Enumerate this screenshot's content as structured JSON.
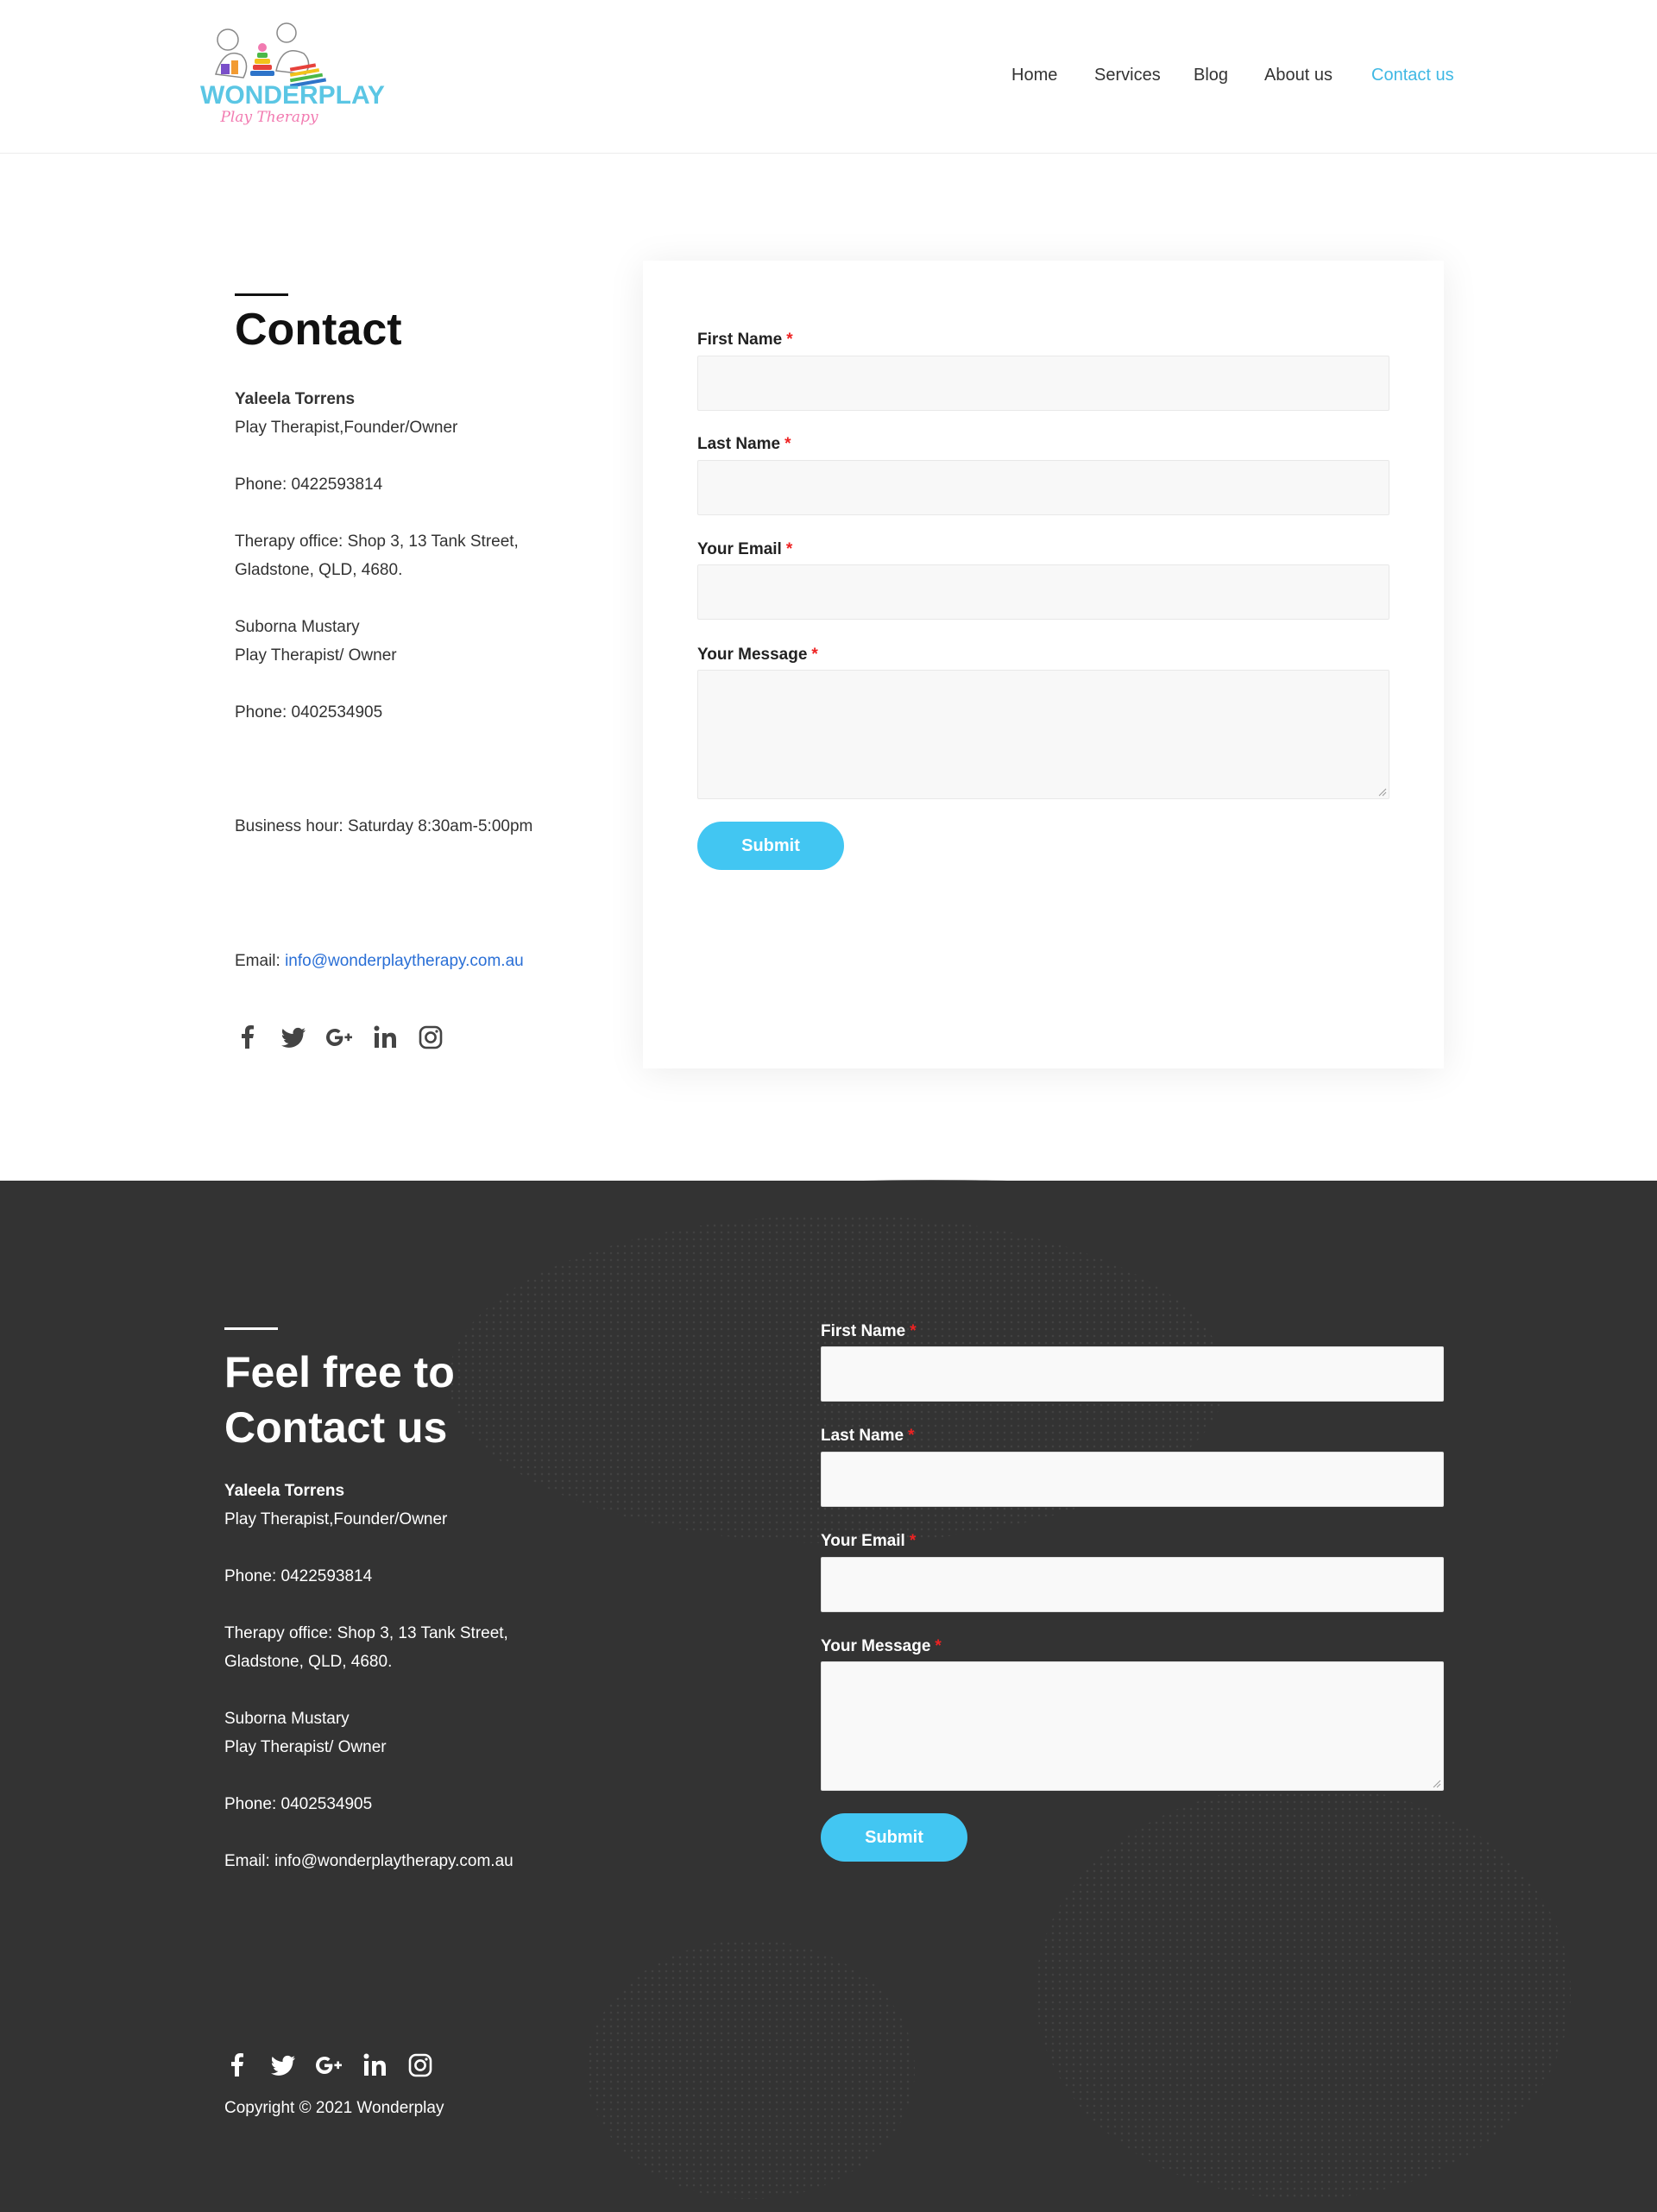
{
  "brand": {
    "name": "WONDERPLAY",
    "tagline": "Play Therapy"
  },
  "nav": {
    "items": [
      {
        "label": "Home"
      },
      {
        "label": "Services"
      },
      {
        "label": "Blog"
      },
      {
        "label": "About us"
      },
      {
        "label": "Contact us",
        "active": true
      }
    ]
  },
  "contact": {
    "title": "Contact",
    "person1_name": "Yaleela Torrens",
    "person1_role": "Play Therapist,Founder/Owner",
    "phone1": "Phone: 0422593814",
    "office_line1": "Therapy office: Shop 3, 13 Tank Street,",
    "office_line2": "Gladstone, QLD, 4680.",
    "person2_name": "Suborna Mustary",
    "person2_role": "Play Therapist/ Owner",
    "phone2": "Phone: 0402534905",
    "hours": "Business hour: Saturday 8:30am-5:00pm",
    "email_prefix": "Email:",
    "email": "info@wonderplaytherapy.com.au",
    "socials": [
      "facebook-icon",
      "twitter-icon",
      "google-plus-icon",
      "linkedin-icon",
      "instagram-icon"
    ]
  },
  "form": {
    "first_name_label": "First Name",
    "last_name_label": "Last Name",
    "email_label": "Your Email",
    "message_label": "Your Message",
    "required_mark": "*",
    "submit_label": "Submit"
  },
  "footer": {
    "title_line1": "Feel free to",
    "title_line2": "Contact us",
    "person1_name": "Yaleela Torrens",
    "person1_role": "Play Therapist,Founder/Owner",
    "phone1": "Phone: 0422593814",
    "office_line1": "Therapy office: Shop 3, 13 Tank Street,",
    "office_line2": "Gladstone, QLD, 4680.",
    "person2_name": "Suborna Mustary",
    "person2_role": "Play Therapist/ Owner",
    "phone2": "Phone: 0402534905",
    "email_line": "Email: info@wonderplaytherapy.com.au",
    "form": {
      "first_name_label": "First Name",
      "last_name_label": "Last Name",
      "email_label": "Your Email",
      "message_label": "Your Message",
      "submit_label": "Submit"
    },
    "copyright": "Copyright © 2021 Wonderplay"
  },
  "colors": {
    "accent": "#42c6f2",
    "nav_active": "#3fb8e4",
    "link": "#2a6fd6",
    "footer_bg": "#333333",
    "required": "#ee2222"
  }
}
